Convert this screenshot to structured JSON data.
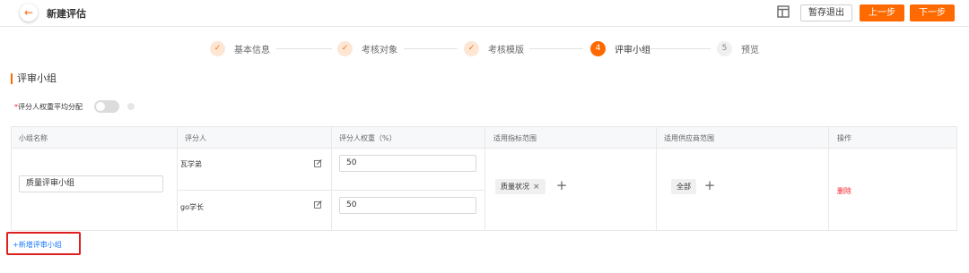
{
  "header": {
    "back_icon": "arrow-left-icon",
    "title": "新建评估",
    "layout_icon": "layout-icon",
    "save_exit_label": "暂存退出",
    "prev_label": "上一步",
    "next_label": "下一步",
    "accent_color": "#ff6a00"
  },
  "steps": [
    {
      "label": "基本信息",
      "marker": "✓",
      "status": "done"
    },
    {
      "label": "考核对象",
      "marker": "✓",
      "status": "done"
    },
    {
      "label": "考核模版",
      "marker": "✓",
      "status": "done"
    },
    {
      "label": "评审小组",
      "marker": "4",
      "status": "active"
    },
    {
      "label": "预览",
      "marker": "5",
      "status": "todo"
    }
  ],
  "section": {
    "title": "评审小组",
    "weight_required_mark": "*",
    "weight_label": "评分人权重平均分配",
    "weight_toggle_on": false
  },
  "table": {
    "headers": [
      "小组名称",
      "评分人",
      "评分人权重（%）",
      "适用指标范围",
      "适用供应商范围",
      "操作"
    ],
    "group": {
      "name": "质量评审小组",
      "raters": [
        {
          "name": "瓦学弟",
          "weight": "50"
        },
        {
          "name": "go学长",
          "weight": "50"
        }
      ],
      "indicator_tag": "质量状况",
      "indicator_tag_close": "×",
      "supplier_tag": "全部",
      "plus": "+",
      "delete_label": "删除"
    }
  },
  "add_group_label": "+新增评审小组"
}
